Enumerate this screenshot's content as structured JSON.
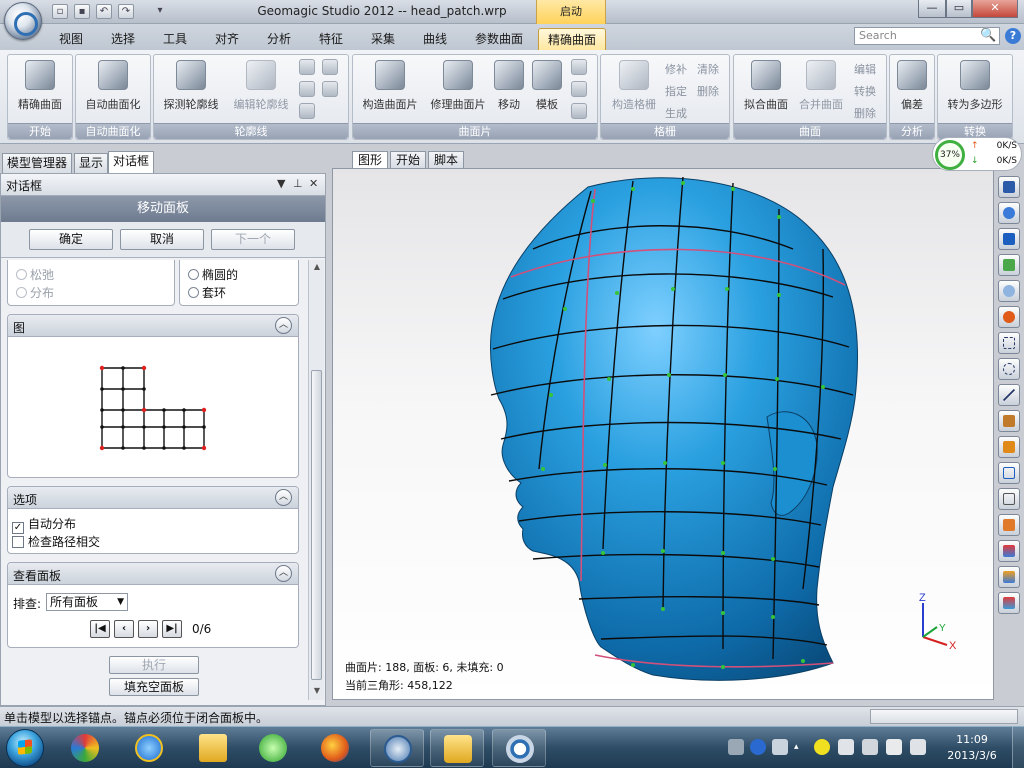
{
  "window": {
    "title": "Geomagic Studio 2012 -- head_patch.wrp",
    "context_tab": "启动"
  },
  "ribbon": {
    "tabs": [
      "视图",
      "选择",
      "工具",
      "对齐",
      "分析",
      "特征",
      "采集",
      "曲线",
      "参数曲面",
      "精确曲面"
    ],
    "active_tab": "精确曲面",
    "search_placeholder": "Search",
    "groups": {
      "start": "开始",
      "auto_surface": "自动曲面化",
      "contour": "轮廓线",
      "patch": "曲面片",
      "grid": "格栅",
      "surface": "曲面",
      "analysis": "分析",
      "convert": "转换"
    },
    "buttons": {
      "precise_surface": "精确曲面",
      "auto_surface": "自动曲面化",
      "detect_contour": "探测轮廓线",
      "edit_contour": "编辑轮廓线",
      "build_patches": "构造曲面片",
      "repair_patches": "修理曲面片",
      "move": "移动",
      "template": "模板",
      "build_grid": "构造格栅",
      "repair": "修补",
      "clear": "清除",
      "assign": "指定",
      "delete": "删除",
      "generate": "生成",
      "fit_surface": "拟合曲面",
      "merge_surface": "合并曲面",
      "edit": "编辑",
      "convert_small": "转换",
      "delete2": "删除",
      "deviation": "偏差",
      "to_polygon": "转为多边形"
    }
  },
  "left_panel": {
    "tabs": [
      "模型管理器",
      "显示",
      "对话框"
    ],
    "active_tab": "对话框",
    "header_title": "对话框",
    "command_title": "移动面板",
    "ok": "确定",
    "cancel": "取消",
    "next": "下一个",
    "radio_relax": "松弛",
    "radio_distribute": "分布",
    "radio_elliptic": "椭圆的",
    "radio_loop": "套环",
    "diagram_title": "图",
    "options_title": "选项",
    "auto_distribute": "自动分布",
    "check_path_intersect": "检查路径相交",
    "view_panel_title": "查看面板",
    "sort_label": "排查:",
    "sort_value": "所有面板",
    "nav_counter": "0/6",
    "execute": "执行",
    "fill_empty": "填充空面板"
  },
  "viewport": {
    "tabs": [
      "图形",
      "开始",
      "脚本"
    ],
    "active_tab": "图形",
    "stats_line1": "曲面片: 188, 面板: 6, 未填充: 0",
    "stats_line2": "当前三角形: 458,122",
    "axis_z": "Z",
    "axis_y": "Y",
    "axis_x": "X",
    "model_color": "#1f95d6",
    "grid_color": "#111111",
    "contour_color": "#d2507a"
  },
  "meter": {
    "percent": "37%",
    "up": "0K/S",
    "down": "0K/S"
  },
  "status": {
    "message": "单击模型以选择锚点。锚点必须位于闭合面板中。"
  },
  "taskbar": {
    "time": "11:09",
    "date": "2013/3/6"
  }
}
